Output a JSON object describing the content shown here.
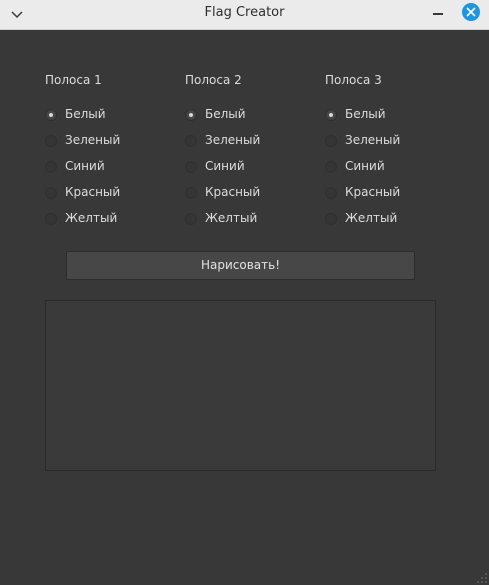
{
  "window": {
    "title": "Flag Creator"
  },
  "stripes": [
    {
      "label": "Полоса 1",
      "selected": "Белый",
      "options": [
        "Белый",
        "Зеленый",
        "Синий",
        "Красный",
        "Желтый"
      ]
    },
    {
      "label": "Полоса 2",
      "selected": "Белый",
      "options": [
        "Белый",
        "Зеленый",
        "Синий",
        "Красный",
        "Желтый"
      ]
    },
    {
      "label": "Полоса 3",
      "selected": "Белый",
      "options": [
        "Белый",
        "Зеленый",
        "Синий",
        "Красный",
        "Желтый"
      ]
    }
  ],
  "draw_button": {
    "label": "Нарисовать!"
  },
  "colors": {
    "titlebar_bg": "#ebebeb",
    "close_button": "#1e96de",
    "window_bg": "#383838"
  }
}
